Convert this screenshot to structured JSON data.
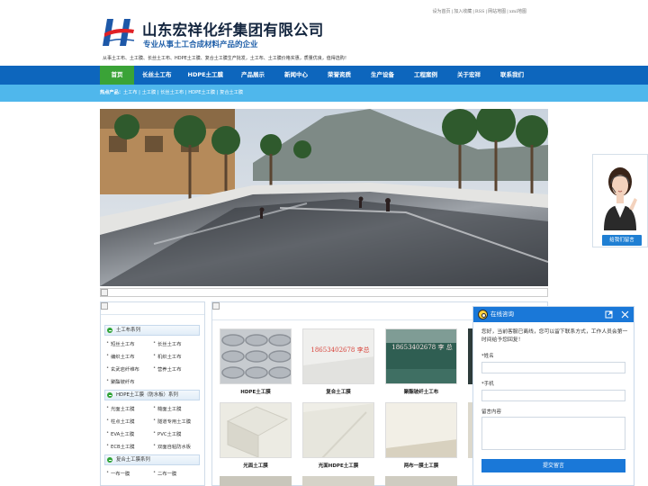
{
  "header": {
    "top_links": [
      "设为首页",
      "加入收藏",
      "RSS",
      "网站地图",
      "xml地图"
    ],
    "company_name": "山东宏祥化纤集团有限公司",
    "slogan": "专业从事土工合成材料产品的企业",
    "intro": "从事土工布、土工膜、长丝土工布、HDPE土工膜、复合土工膜生产批发，土工布、土工膜价格实惠，质量优良，值得选购！"
  },
  "nav": {
    "items": [
      "首页",
      "长丝土工布",
      "HDPE土工膜",
      "产品展示",
      "新闻中心",
      "荣誉资质",
      "生产设备",
      "工程案例",
      "关于宏祥",
      "联系我们"
    ]
  },
  "hot": {
    "label": "热点产品：",
    "items": [
      "土工布",
      "土工膜",
      "长丝土工布",
      "HDPE土工膜",
      "复合土工膜"
    ]
  },
  "sidebar": {
    "categories": [
      {
        "title": "土工布系列",
        "items": [
          "短丝土工布",
          "长丝土工布",
          "编织土工布",
          "机织土工布",
          "玄武岩纤维布",
          "营养土工布",
          "聚酯玻纤布"
        ]
      },
      {
        "title": "HDPE土工膜（防水板）系列",
        "items": [
          "光面土工膜",
          "糙面土工膜",
          "柱点土工膜",
          "隧道专用土工膜",
          "EVA土工膜",
          "PVC土工膜",
          "ECB土工膜",
          "双面自粘防水板"
        ]
      },
      {
        "title": "复合土工膜系列",
        "items": [
          "一布一膜",
          "二布一膜"
        ]
      }
    ]
  },
  "products": {
    "items": [
      {
        "name": "HDPE土工膜",
        "watermark": ""
      },
      {
        "name": "复合土工膜",
        "watermark": "18653402678 李总"
      },
      {
        "name": "聚酯玻纤土工布",
        "watermark": "18653402678 李 总"
      },
      {
        "name": "光面土工膜",
        "watermark": ""
      },
      {
        "name": "光面HDPE土工膜",
        "watermark": ""
      },
      {
        "name": "两布一膜土工膜",
        "watermark": ""
      }
    ]
  },
  "service": {
    "button_label": "给我们留言"
  },
  "chat": {
    "title": "在线咨询",
    "message": "您好，当前客服已离线，您可以留下联系方式，工作人员会第一时间给予您回复！",
    "fields": [
      "*姓名",
      "*手机",
      "留言内容"
    ],
    "submit_label": "提交留言"
  }
}
